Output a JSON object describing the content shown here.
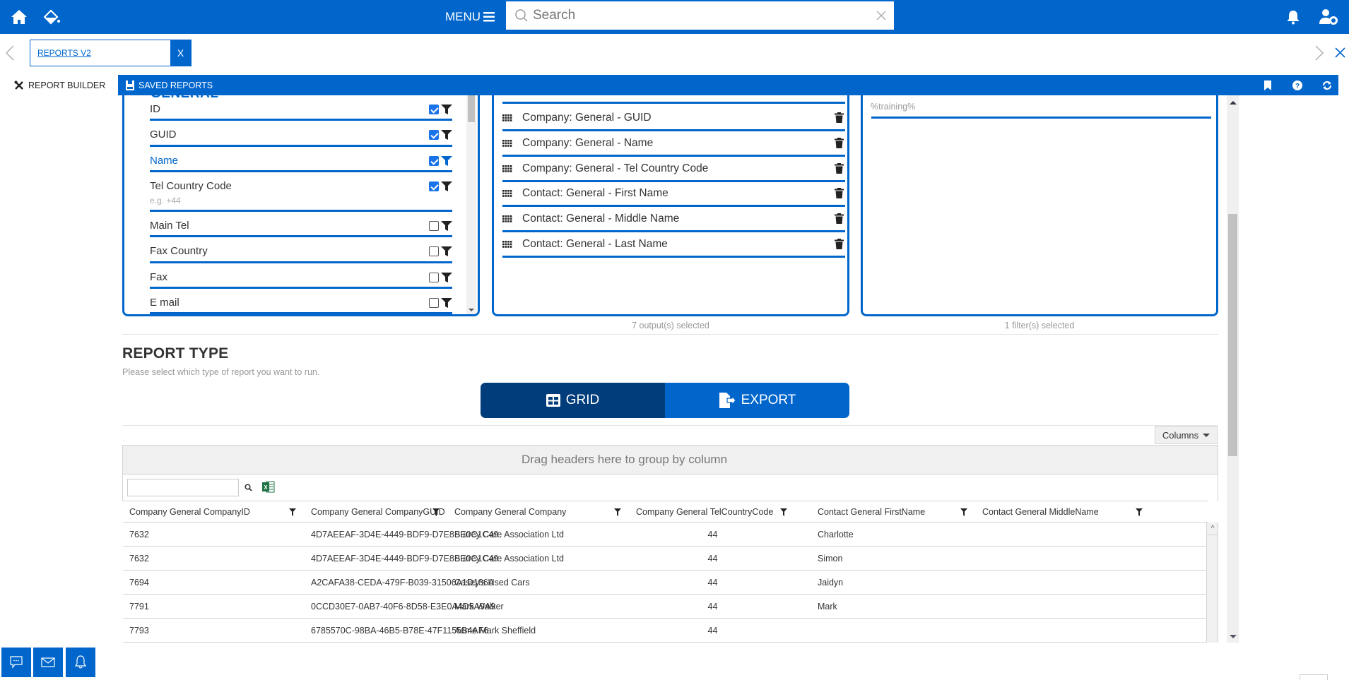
{
  "header": {
    "menu_label": "MENU",
    "search_placeholder": "Search",
    "icons": [
      "home-icon",
      "paint-bucket-icon",
      "bell-icon",
      "user-settings-icon"
    ]
  },
  "tabs": [
    {
      "label": "REPORTS V2",
      "close": "X"
    }
  ],
  "toolbar": {
    "report_builder": "REPORT BUILDER",
    "saved_reports": "SAVED REPORTS",
    "icons": [
      "bookmark-icon",
      "help-icon",
      "refresh-icon"
    ]
  },
  "fields_panel": {
    "section_title": "GENERAL",
    "items": [
      {
        "name": "ID",
        "checked": true,
        "highlight": false,
        "hint": ""
      },
      {
        "name": "GUID",
        "checked": true,
        "highlight": false,
        "hint": ""
      },
      {
        "name": "Name",
        "checked": true,
        "highlight": true,
        "hint": ""
      },
      {
        "name": "Tel Country Code",
        "checked": true,
        "highlight": false,
        "hint": "e.g. +44"
      },
      {
        "name": "Main Tel",
        "checked": false,
        "highlight": false,
        "hint": ""
      },
      {
        "name": "Fax Country",
        "checked": false,
        "highlight": false,
        "hint": ""
      },
      {
        "name": "Fax",
        "checked": false,
        "highlight": false,
        "hint": ""
      },
      {
        "name": "E mail",
        "checked": false,
        "highlight": false,
        "hint": ""
      }
    ]
  },
  "outputs_panel": {
    "items": [
      "Company: General - GUID",
      "Company: General - Name",
      "Company: General - Tel Country Code",
      "Contact: General - First Name",
      "Contact: General - Middle Name",
      "Contact: General - Last Name"
    ],
    "caption": "7 output(s) selected"
  },
  "filters_panel": {
    "value": "%training%",
    "caption": "1 filter(s) selected"
  },
  "report_type": {
    "title": "REPORT TYPE",
    "subtitle": "Please select which type of report you want to run.",
    "grid_label": "GRID",
    "export_label": "EXPORT",
    "selected": "GRID",
    "colors": {
      "selected": "#003d7a",
      "unselected": "#0066cc"
    }
  },
  "grid": {
    "columns_button": "Columns",
    "group_panel_text": "Drag headers here to group by column",
    "search_value": "",
    "headers": [
      "Company General CompanyID",
      "Company General CompanyGUID",
      "Company General Company",
      "Company General TelCountryCode",
      "Contact General FirstName",
      "Contact General MiddleName"
    ],
    "rows": [
      [
        "7632",
        "4D7AEEAF-3D4E-4449-BDF9-D7E8BE0C1C49",
        "Surrey Care Association Ltd",
        "44",
        "Charlotte",
        ""
      ],
      [
        "7632",
        "4D7AEEAF-3D4E-4449-BDF9-D7E8BE0C1C49",
        "Surrey Care Association Ltd",
        "44",
        "Simon",
        ""
      ],
      [
        "7694",
        "A2CAFA38-CEDA-479F-B039-31506A1D186A",
        "Casey's Used Cars",
        "44",
        "Jaidyn",
        ""
      ],
      [
        "7791",
        "0CCD30E7-0AB7-40F6-8D58-E3E0A4D5A9A9",
        "Mark Walker",
        "44",
        "Mark",
        ""
      ],
      [
        "7793",
        "6785570C-98BA-46B5-B78E-47F1155B4AF6",
        "Acme Mark Sheffield",
        "44",
        "",
        ""
      ]
    ]
  },
  "bottom_buttons": [
    "chat-icon",
    "mail-icon",
    "bell-icon"
  ],
  "colors": {
    "brand": "#0066cc",
    "dark_brand": "#003d7a"
  }
}
